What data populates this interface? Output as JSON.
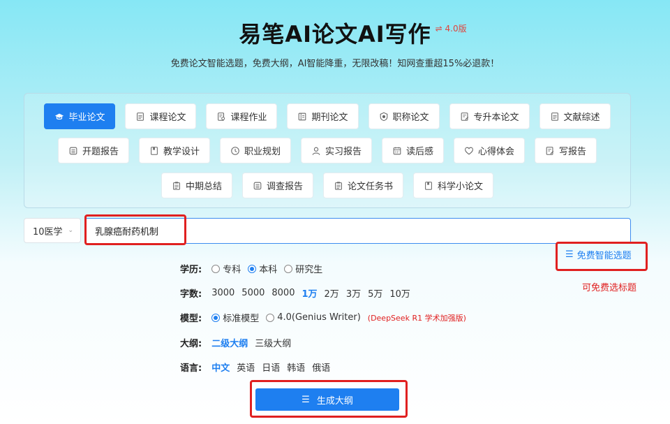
{
  "header": {
    "title": "易笔AI论文AI写作",
    "version": "⇌ 4.0版",
    "subtitle": "免费论文智能选题，免费大纲，AI智能降重，无限改稿！知网查重超15%必退款！"
  },
  "paper_types": {
    "row1": [
      {
        "label": "毕业论文",
        "icon": "graduation-cap-icon",
        "active": true
      },
      {
        "label": "课程论文",
        "icon": "document-icon"
      },
      {
        "label": "课程作业",
        "icon": "document-search-icon"
      },
      {
        "label": "期刊论文",
        "icon": "journal-icon"
      },
      {
        "label": "职称论文",
        "icon": "badge-icon"
      },
      {
        "label": "专升本论文",
        "icon": "document-edit-icon"
      },
      {
        "label": "文献综述",
        "icon": "document-icon"
      }
    ],
    "row2": [
      {
        "label": "开题报告",
        "icon": "report-icon"
      },
      {
        "label": "教学设计",
        "icon": "book-icon"
      },
      {
        "label": "职业规划",
        "icon": "clock-icon"
      },
      {
        "label": "实习报告",
        "icon": "user-icon"
      },
      {
        "label": "读后感",
        "icon": "calendar-icon"
      },
      {
        "label": "心得体会",
        "icon": "heart-icon"
      },
      {
        "label": "写报告",
        "icon": "document-edit-icon"
      }
    ],
    "row3": [
      {
        "label": "中期总结",
        "icon": "clipboard-icon"
      },
      {
        "label": "调查报告",
        "icon": "report-icon"
      },
      {
        "label": "论文任务书",
        "icon": "clipboard-icon"
      },
      {
        "label": "科学小论文",
        "icon": "book-icon"
      }
    ]
  },
  "subject": {
    "value": "10医学"
  },
  "topic": {
    "value": "乳腺癌耐药机制"
  },
  "free_topic": {
    "label": "免费智能选题"
  },
  "free_note": "可免费选标题",
  "options": {
    "degree": {
      "label": "学历:",
      "choices": [
        "专科",
        "本科",
        "研究生"
      ],
      "selected": "本科"
    },
    "word_count": {
      "label": "字数:",
      "choices": [
        "3000",
        "5000",
        "8000",
        "1万",
        "2万",
        "3万",
        "5万",
        "10万"
      ],
      "selected": "1万"
    },
    "model": {
      "label": "模型:",
      "choices": [
        "标准模型",
        "4.0(Genius Writer)"
      ],
      "selected": "标准模型",
      "note": "(DeepSeek R1 学术加强版)"
    },
    "outline": {
      "label": "大纲:",
      "choices": [
        "二级大纲",
        "三级大纲"
      ],
      "selected": "二级大纲"
    },
    "language": {
      "label": "语言:",
      "choices": [
        "中文",
        "英语",
        "日语",
        "韩语",
        "俄语"
      ],
      "selected": "中文"
    }
  },
  "generate_button": {
    "label": "生成大纲"
  },
  "colors": {
    "accent": "#1e7ff0",
    "highlight": "#e02020"
  }
}
